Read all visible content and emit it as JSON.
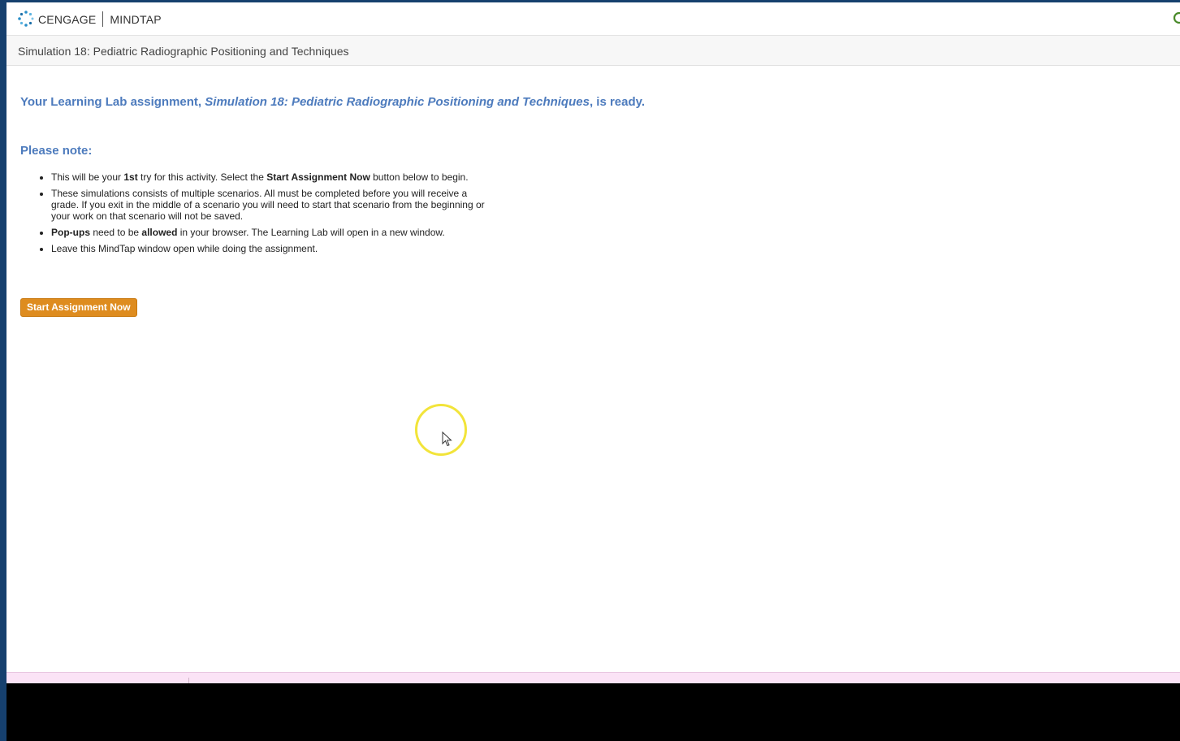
{
  "header": {
    "brand_left": "CENGAGE",
    "brand_right": "MINDTAP",
    "logo_icon": "cengage-logo-icon",
    "corner_icon": "partial-refresh-icon"
  },
  "titlebar": {
    "title": "Simulation 18: Pediatric Radiographic Positioning and Techniques"
  },
  "main": {
    "ready_prefix": "Your Learning Lab assignment, ",
    "ready_title": "Simulation 18: Pediatric Radiographic Positioning and Techniques",
    "ready_suffix": ", is ready.",
    "note_heading": "Please note:",
    "notes": {
      "n1_a": "This will be your ",
      "n1_b": "1st",
      "n1_c": " try for this activity. Select the ",
      "n1_d": "Start Assignment Now",
      "n1_e": " button below to begin.",
      "n2": "These simulations consists of multiple scenarios. All must be completed before you will receive a grade. If you exit in the middle of a scenario you will need to start that scenario from the beginning or your work on that scenario will not be saved.",
      "n3_a": "Pop-ups",
      "n3_b": " need to be ",
      "n3_c": "allowed",
      "n3_d": " in your browser. The Learning Lab will open in a new window.",
      "n4": "Leave this MindTap window open while doing the assignment."
    },
    "start_button": "Start Assignment Now"
  },
  "colors": {
    "accent_blue": "#4d7bbd",
    "button_orange": "#de8c1f",
    "outer_frame": "#16406e",
    "cursor_highlight": "#f2e43a"
  }
}
